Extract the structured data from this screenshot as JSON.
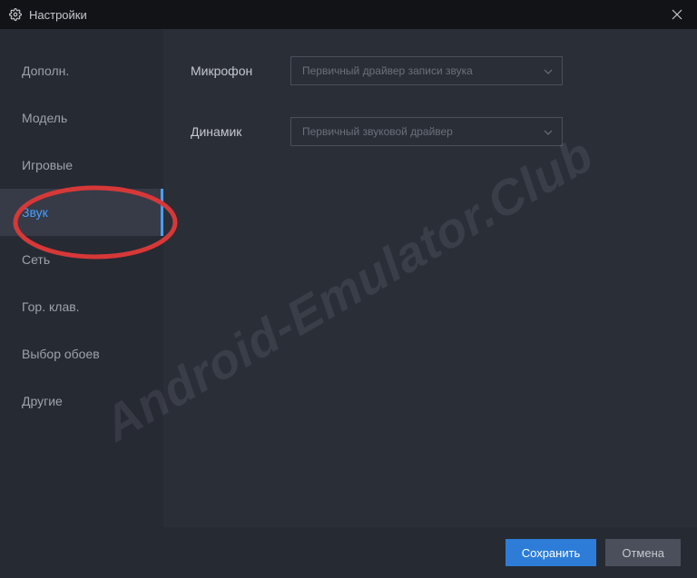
{
  "titlebar": {
    "title": "Настройки"
  },
  "sidebar": {
    "items": [
      {
        "label": "Дополн."
      },
      {
        "label": "Модель"
      },
      {
        "label": "Игровые"
      },
      {
        "label": "Звук"
      },
      {
        "label": "Сеть"
      },
      {
        "label": "Гор. клав."
      },
      {
        "label": "Выбор обоев"
      },
      {
        "label": "Другие"
      }
    ]
  },
  "main": {
    "microphone": {
      "label": "Микрофон",
      "value": "Первичный драйвер записи звука"
    },
    "speaker": {
      "label": "Динамик",
      "value": "Первичный звуковой драйвер"
    }
  },
  "footer": {
    "save": "Сохранить",
    "cancel": "Отмена"
  },
  "watermark": "Android-Emulator.Club"
}
